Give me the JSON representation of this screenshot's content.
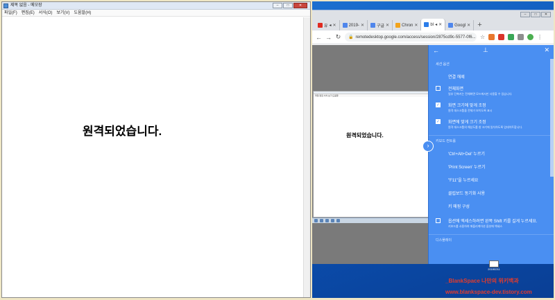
{
  "notepad": {
    "title": "제목 없음 - 메모장",
    "menu": [
      "파일(F)",
      "편집(E)",
      "서식(O)",
      "보기(V)",
      "도움말(H)"
    ],
    "content": "원격되었습니다."
  },
  "chrome": {
    "tabs": [
      {
        "label": "유",
        "favicon_color": "#e02b20",
        "active": false
      },
      {
        "label": "2019-",
        "favicon_color": "#4f86ec",
        "active": false
      },
      {
        "label": "구글",
        "favicon_color": "#4f86ec",
        "active": false
      },
      {
        "label": "Chron",
        "favicon_color": "#f2a31b",
        "active": false
      },
      {
        "label": "bl",
        "favicon_color": "#2b7de9",
        "active": true
      },
      {
        "label": "Googl",
        "favicon_color": "#4f86ec",
        "active": false
      }
    ],
    "new_tab_glyph": "+",
    "url": "remotedesktop.google.com/access/session/2875cd9c-5577-0f6..."
  },
  "remote": {
    "notepad_menu": "파일 편집 서식 보기 도움말",
    "content": "원격되었습니다."
  },
  "panel": {
    "section1": "세션 옵션",
    "disconnect": "연결 해제",
    "fullscreen": {
      "label": "전체화면",
      "desc": "일부 단축키는 전체화면 모드에서만 사용할 수 있습니다.",
      "checked": false
    },
    "fit_screen": {
      "label": "화면 크기에 맞게 조정",
      "desc": "원격 데스크톱을 전체가 보이도록 표시",
      "checked": true
    },
    "resize_fit": {
      "label": "화면에 맞게 크기 조정",
      "desc": "원격 데스크톱의 해상도를 창 크기에 일치하도록 업데이트합니다.",
      "checked": true
    },
    "section2": "키보드 컨트롤",
    "ctrl_alt_del": "'Ctrl+Alt+Del' 누르기",
    "print_screen": "'Print Screen' 누르기",
    "f11": "\"F11\"을 누르세요",
    "clipboard": "클립보드 동기화 사용",
    "key_mapping": "키 매핑 구성",
    "shift_option": {
      "label": "옵션에 액세스하려면 왼쪽 Shift 키를 길게 누르세요.",
      "desc": "키보드를 사용하여 애플리케이션 옵션에 액세스",
      "checked": false
    },
    "section3": "디스플레이"
  },
  "desktop": {
    "icon_label": "20190211"
  },
  "watermark": {
    "line1": "_BlankSpace 나만의 위키백과",
    "line2": "www.blankspace-dev.tistory.com"
  },
  "colors": {
    "panel_blue": "#4a8ff2",
    "watermark_red": "#e63b2a",
    "desktop_blue": "#1b6fd0"
  }
}
